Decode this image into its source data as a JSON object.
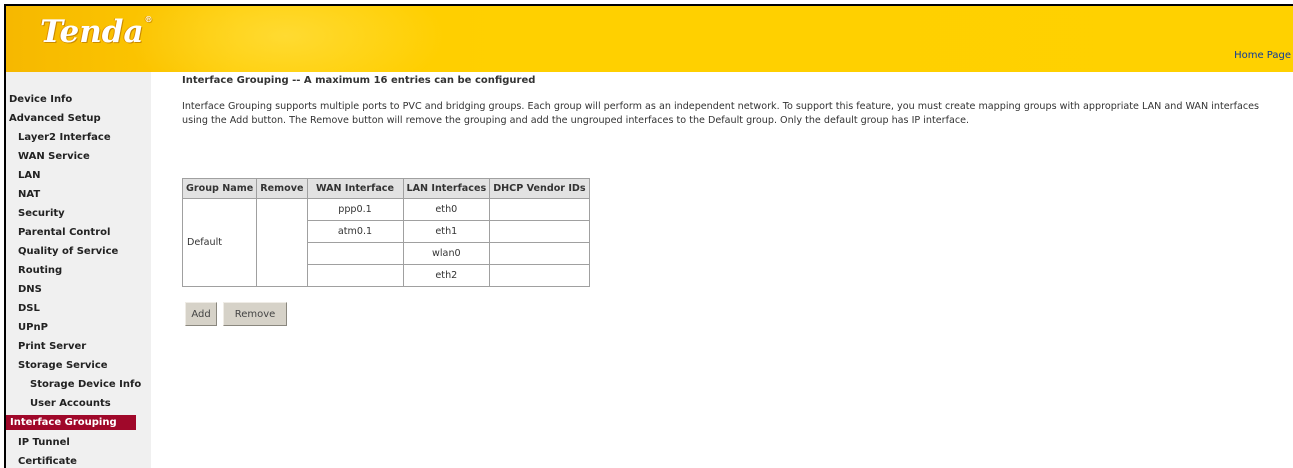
{
  "header": {
    "logo_text": "Tenda",
    "logo_mark": "®",
    "home_link": "Home Page"
  },
  "sidebar": {
    "items": [
      {
        "label": "Device Info",
        "level": 0
      },
      {
        "label": "Advanced Setup",
        "level": 0
      },
      {
        "label": "Layer2 Interface",
        "level": 1
      },
      {
        "label": "WAN Service",
        "level": 1
      },
      {
        "label": "LAN",
        "level": 1
      },
      {
        "label": "NAT",
        "level": 1
      },
      {
        "label": "Security",
        "level": 1
      },
      {
        "label": "Parental Control",
        "level": 1
      },
      {
        "label": "Quality of Service",
        "level": 1
      },
      {
        "label": "Routing",
        "level": 1
      },
      {
        "label": "DNS",
        "level": 1
      },
      {
        "label": "DSL",
        "level": 1
      },
      {
        "label": "UPnP",
        "level": 1
      },
      {
        "label": "Print Server",
        "level": 1
      },
      {
        "label": "Storage Service",
        "level": 1
      },
      {
        "label": "Storage Device Info",
        "level": 2
      },
      {
        "label": "User Accounts",
        "level": 2
      },
      {
        "label": "Interface Grouping",
        "level": 1,
        "active": true
      },
      {
        "label": "IP Tunnel",
        "level": 1
      },
      {
        "label": "Certificate",
        "level": 1
      }
    ]
  },
  "main": {
    "title": "Interface Grouping -- A maximum 16 entries can be configured",
    "description": "Interface Grouping supports multiple ports to PVC and bridging groups. Each group will perform as an independent network. To support this feature, you must create mapping groups with appropriate LAN and WAN interfaces using the Add button. The Remove button will remove the grouping and add the ungrouped interfaces to the Default group. Only the default group has IP interface.",
    "table": {
      "headers": [
        "Group Name",
        "Remove",
        "WAN Interface",
        "LAN Interfaces",
        "DHCP Vendor IDs"
      ],
      "group_name": "Default",
      "rows": [
        {
          "wan": "ppp0.1",
          "lan": "eth0",
          "dhcp": ""
        },
        {
          "wan": "atm0.1",
          "lan": "eth1",
          "dhcp": ""
        },
        {
          "wan": "",
          "lan": "wlan0",
          "dhcp": ""
        },
        {
          "wan": "",
          "lan": "eth2",
          "dhcp": ""
        }
      ]
    },
    "buttons": {
      "add": "Add",
      "remove": "Remove"
    }
  },
  "colors": {
    "header_yellow": "#ffd100",
    "active_nav": "#a0082a",
    "sidebar_bg": "#f0f0f0",
    "link_blue": "#0b3a9b"
  }
}
